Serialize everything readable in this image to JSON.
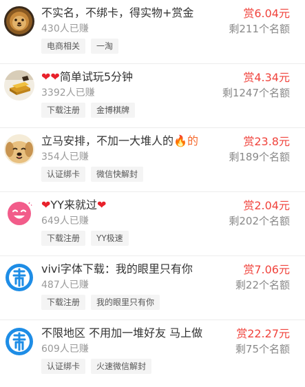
{
  "tasks": [
    {
      "title": "不实名，不绑卡，得实物+赏金",
      "earned": "430人已赚",
      "tags": [
        "电商相关",
        "一淘"
      ],
      "reward": "赏6.04元",
      "remaining": "剩211个名额",
      "avatar_icon": "lion-avatar-icon"
    },
    {
      "title_prefix": "❤❤",
      "title": "简单试玩5分钟",
      "earned": "3392人已赚",
      "tags": [
        "下载注册",
        "金博棋牌"
      ],
      "reward": "赏4.34元",
      "remaining": "剩1247个名额",
      "avatar_icon": "gold-bars-avatar-icon"
    },
    {
      "title": "立马安排，不加一大堆人的",
      "title_suffix": "🔥的",
      "earned": "354人已赚",
      "tags": [
        "认证绑卡",
        "微信快解封"
      ],
      "reward": "赏23.8元",
      "remaining": "剩189个名额",
      "avatar_icon": "dog-avatar-icon"
    },
    {
      "title_prefix": "❤",
      "title": "YY来就过",
      "title_suffix": "❤",
      "earned": "649人已赚",
      "tags": [
        "下载注册",
        "YY极速"
      ],
      "reward": "赏2.04元",
      "remaining": "剩202个名额",
      "avatar_icon": "pink-smiley-avatar-icon"
    },
    {
      "title": "vivi字体下载：我的眼里只有你",
      "earned": "487人已赚",
      "tags": [
        "下载注册",
        "我的眼里只有你"
      ],
      "reward": "赏7.06元",
      "remaining": "剩22个名额",
      "avatar_icon": "bang-logo-avatar-icon"
    },
    {
      "title": "不限地区 不用加一堆好友 马上做",
      "earned": "609人已赚",
      "tags": [
        "认证绑卡",
        "火速微信解封"
      ],
      "reward": "赏22.27元",
      "remaining": "剩75个名额",
      "avatar_icon": "bang-logo-avatar-icon"
    }
  ],
  "colors": {
    "reward": "#f0433c",
    "heart": "#e8212b",
    "muted_text": "#999999",
    "tag_bg": "#f4f4f4",
    "bang_blue": "#1e8de6"
  }
}
